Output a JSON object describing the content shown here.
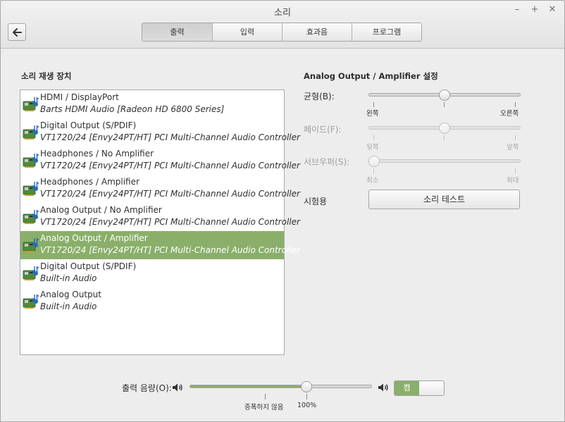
{
  "window": {
    "title": "소리"
  },
  "tabs": [
    {
      "label": "출력",
      "active": true
    },
    {
      "label": "입력",
      "active": false
    },
    {
      "label": "효과음",
      "active": false
    },
    {
      "label": "프로그램",
      "active": false
    }
  ],
  "devices_section": {
    "title": "소리 재생 장치",
    "items": [
      {
        "name": "HDMI / DisplayPort",
        "desc": "Barts HDMI Audio [Radeon HD 6800 Series]",
        "icon": "sound-card-icon",
        "selected": false
      },
      {
        "name": "Digital Output (S/PDIF)",
        "desc": "VT1720/24 [Envy24PT/HT] PCI Multi-Channel Audio Controller",
        "icon": "sound-card-icon",
        "selected": false
      },
      {
        "name": "Headphones / No Amplifier",
        "desc": "VT1720/24 [Envy24PT/HT] PCI Multi-Channel Audio Controller",
        "icon": "sound-card-icon",
        "selected": false
      },
      {
        "name": "Headphones / Amplifier",
        "desc": "VT1720/24 [Envy24PT/HT] PCI Multi-Channel Audio Controller",
        "icon": "sound-card-icon",
        "selected": false
      },
      {
        "name": "Analog Output / No Amplifier",
        "desc": "VT1720/24 [Envy24PT/HT] PCI Multi-Channel Audio Controller",
        "icon": "sound-card-icon",
        "selected": false
      },
      {
        "name": "Analog Output / Amplifier",
        "desc": "VT1720/24 [Envy24PT/HT] PCI Multi-Channel Audio Controller",
        "icon": "sound-card-icon",
        "selected": true
      },
      {
        "name": "Digital Output (S/PDIF)",
        "desc": "Built-in Audio",
        "icon": "sound-card-icon",
        "selected": false
      },
      {
        "name": "Analog Output",
        "desc": "Built-in Audio",
        "icon": "sound-card-icon",
        "selected": false
      }
    ]
  },
  "settings": {
    "title": "Analog Output / Amplifier 설정",
    "balance": {
      "label": "균형(B):",
      "left": "왼쪽",
      "right": "오른쪽",
      "value": 0.5,
      "enabled": true
    },
    "fade": {
      "label": "페이드(F):",
      "left": "뒷쪽",
      "right": "앞쪽",
      "value": 0.5,
      "enabled": false
    },
    "subwoofer": {
      "label": "서브우퍼(S):",
      "left": "최소",
      "right": "최대",
      "value": 0.0,
      "enabled": false
    },
    "test": {
      "label": "시험용",
      "button": "소리 테스트"
    }
  },
  "output_volume": {
    "label": "출력 음량(O):",
    "tick_amplify": "증폭하지 않음",
    "tick_100": "100%",
    "value_fraction": 0.64,
    "mute_toggle": {
      "on_label": "켬",
      "state": "on"
    }
  },
  "colors": {
    "accent": "#8aaf6a"
  }
}
